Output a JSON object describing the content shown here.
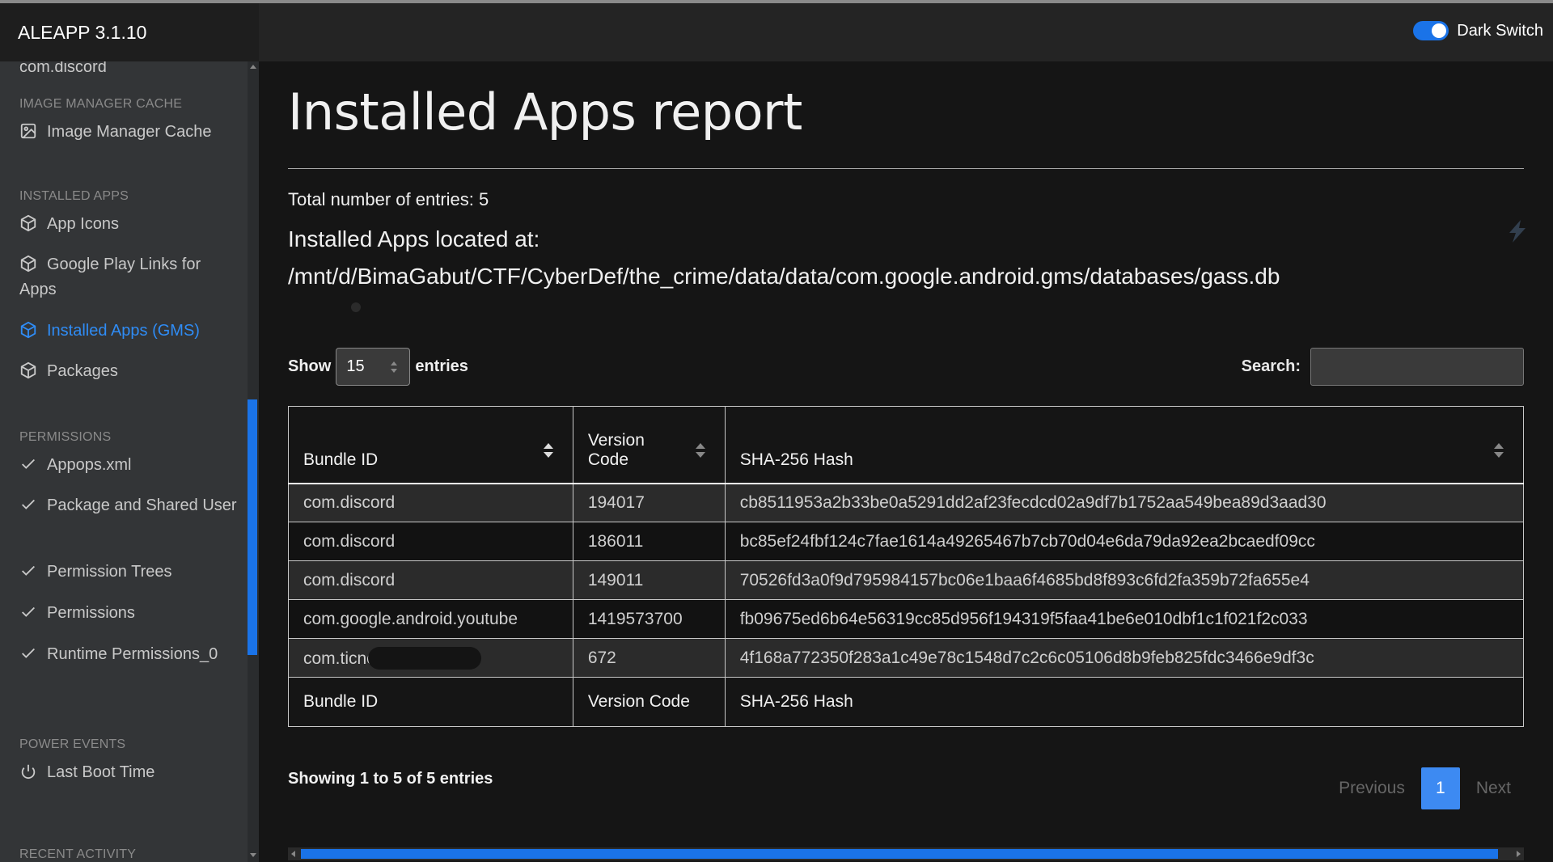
{
  "app": {
    "title": "ALEAPP 3.1.10",
    "dark_switch_label": "Dark Switch"
  },
  "sidebar": {
    "top_item": "com.discord",
    "sections": [
      {
        "heading": "IMAGE MANAGER CACHE",
        "items": [
          "Image Manager Cache"
        ]
      },
      {
        "heading": "INSTALLED APPS",
        "items": [
          "App Icons",
          "Google Play Links for Apps",
          "Installed Apps (GMS)",
          "Packages"
        ]
      },
      {
        "heading": "PERMISSIONS",
        "items": [
          "Appops.xml",
          "Package and Shared User",
          "Permission Trees",
          "Permissions",
          "Runtime Permissions_0"
        ]
      },
      {
        "heading": "POWER EVENTS",
        "items": [
          "Last Boot Time"
        ]
      },
      {
        "heading": "RECENT ACTIVITY",
        "items": []
      }
    ],
    "active_item": "Installed Apps (GMS)"
  },
  "report": {
    "title": "Installed Apps report",
    "total_entries": "Total number of entries: 5",
    "located_at_label": "Installed Apps located at:",
    "located_at_path": "/mnt/d/BimaGabut/CTF/CyberDef/the_crime/data/data/com.google.android.gms/databases/gass.db"
  },
  "table_controls": {
    "show_label": "Show",
    "show_value": "15",
    "entries_label": "entries",
    "search_label": "Search:",
    "search_value": ""
  },
  "table": {
    "columns": [
      "Bundle ID",
      "Version\nCode",
      "SHA-256 Hash"
    ],
    "footer": [
      "Bundle ID",
      "Version Code",
      "SHA-256 Hash"
    ],
    "rows": [
      [
        "com.discord",
        "194017",
        "cb8511953a2b33be0a5291dd2af23fecdcd02a9df7b1752aa549bea89d3aad30"
      ],
      [
        "com.discord",
        "186011",
        "bc85ef24fbf124c7fae1614a49265467b7cb70d04e6da79da92ea2bcaedf09cc"
      ],
      [
        "com.discord",
        "149011",
        "70526fd3a0f9d795984157bc06e1baa6f4685bd8f893c6fd2fa359b72fa655e4"
      ],
      [
        "com.google.android.youtube",
        "1419573700",
        "fb09675ed6b64e56319cc85d956f194319f5faa41be6e010dbf1c1f021f2c033"
      ],
      [
        "com.ticno",
        "672",
        "4f168a772350f283a1c49e78c1548d7c2c6c05106d8b9feb825fdc3466e9df3c"
      ]
    ]
  },
  "pagination": {
    "info": "Showing 1 to 5 of 5 entries",
    "previous": "Previous",
    "current_page": "1",
    "next": "Next"
  },
  "colors": {
    "accent": "#1a73e8",
    "active_link": "#2f8cf5",
    "page_button": "#3d8af2"
  }
}
